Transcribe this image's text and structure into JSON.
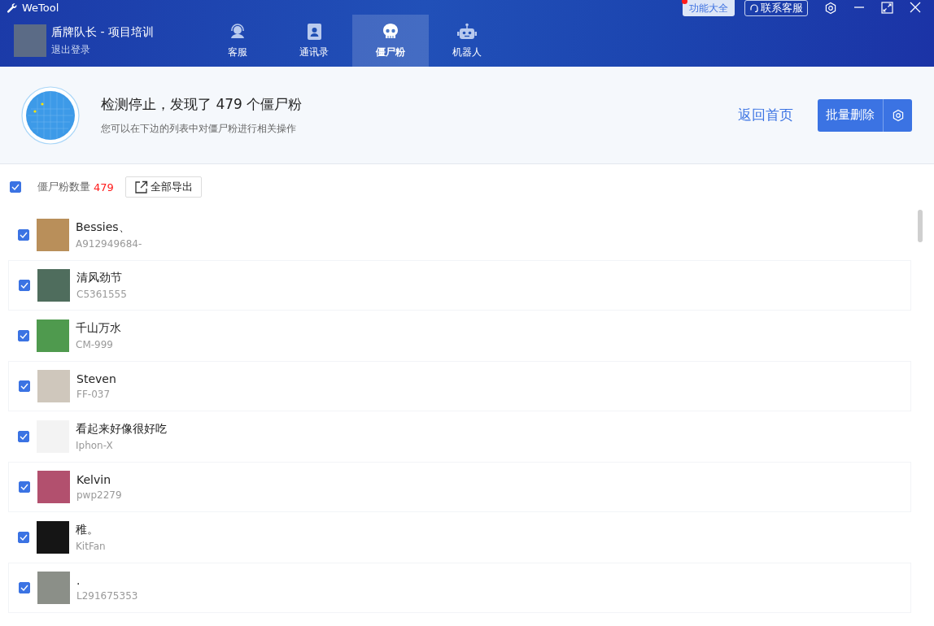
{
  "window": {
    "title": "WeTool"
  },
  "account": {
    "name": "盾牌队长 - 项目培训",
    "logout": "退出登录"
  },
  "tabs": [
    {
      "label": "客服",
      "kind": "headset",
      "selected": false
    },
    {
      "label": "通讯录",
      "kind": "contacts",
      "selected": false
    },
    {
      "label": "僵尸粉",
      "kind": "skull",
      "selected": true
    },
    {
      "label": "机器人",
      "kind": "robot",
      "selected": false
    }
  ],
  "top_buttons": {
    "features": "功能大全",
    "features_badge": true,
    "support": "联系客服"
  },
  "scan": {
    "title": "检测停止，发现了 479 个僵尸粉",
    "subtitle": "您可以在下边的列表中对僵尸粉进行相关操作",
    "home_link": "返回首页",
    "delete_button": "批量删除"
  },
  "toolbar": {
    "select_all_checked": true,
    "count_label": "僵尸粉数量",
    "count": "479",
    "export_button": "全部导出"
  },
  "contacts": [
    {
      "name": "Bessies、",
      "id": "A912949684-",
      "checked": true
    },
    {
      "name": "清风劲节",
      "id": "C5361555",
      "checked": true
    },
    {
      "name": "千山万水",
      "id": "CM-999",
      "checked": true
    },
    {
      "name": "Steven",
      "id": "FF-037",
      "checked": true
    },
    {
      "name": "看起来好像很好吃",
      "id": "Iphon-X",
      "checked": true
    },
    {
      "name": "Kelvin",
      "id": "pwp2279",
      "checked": true
    },
    {
      "name": "稚。",
      "id": "KitFan",
      "checked": true
    },
    {
      "name": ".",
      "id": "L291675353",
      "checked": true
    }
  ]
}
